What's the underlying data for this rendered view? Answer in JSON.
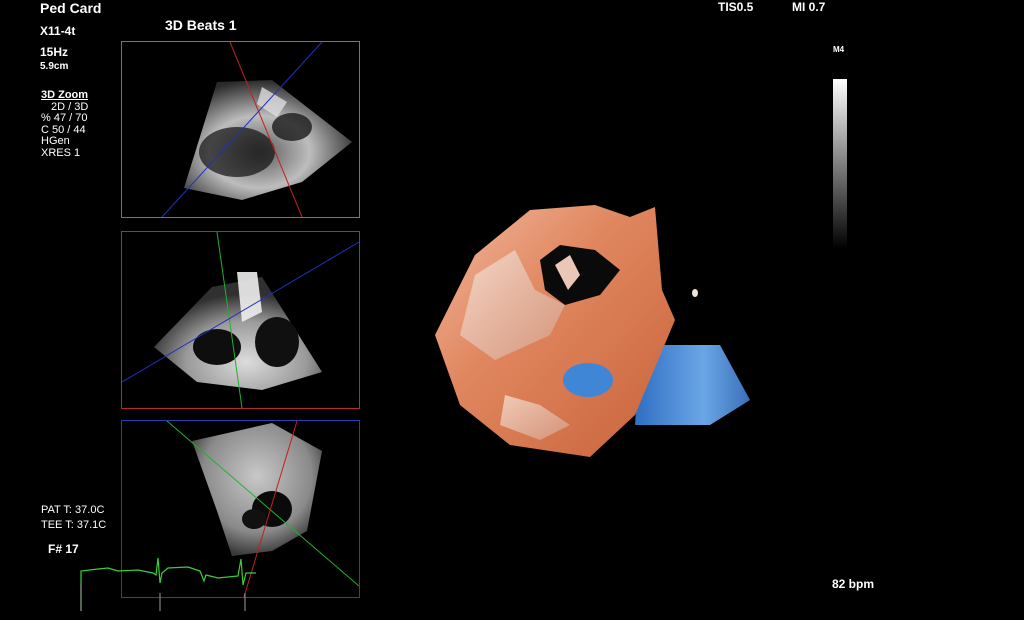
{
  "header": {
    "app_name": "Ped Card",
    "probe": "X11-4t",
    "frame_rate": "15Hz",
    "depth": "5.9cm",
    "mode_title": "3D Beats 1",
    "tis": "TIS0.5",
    "mi": "MI 0.7"
  },
  "params": {
    "zoom_title": "3D Zoom",
    "line1": "2D / 3D",
    "line2": "% 47 / 70",
    "line3": "C  50 / 44",
    "line4": "HGen",
    "line5": "XRES 1"
  },
  "map": {
    "label": "M4"
  },
  "temps": {
    "pat": "PAT T: 37.0C",
    "tee": "TEE T: 37.1C"
  },
  "frame_number": "F# 17",
  "heart_rate": "82 bpm",
  "colors": {
    "green_frame": "#2fa33a",
    "red_frame": "#b52a2a",
    "blue_frame": "#2a3fb5",
    "ecg_trace": "#38d038",
    "tissue": "#e39a7a",
    "blood": "#4a8fd6"
  }
}
